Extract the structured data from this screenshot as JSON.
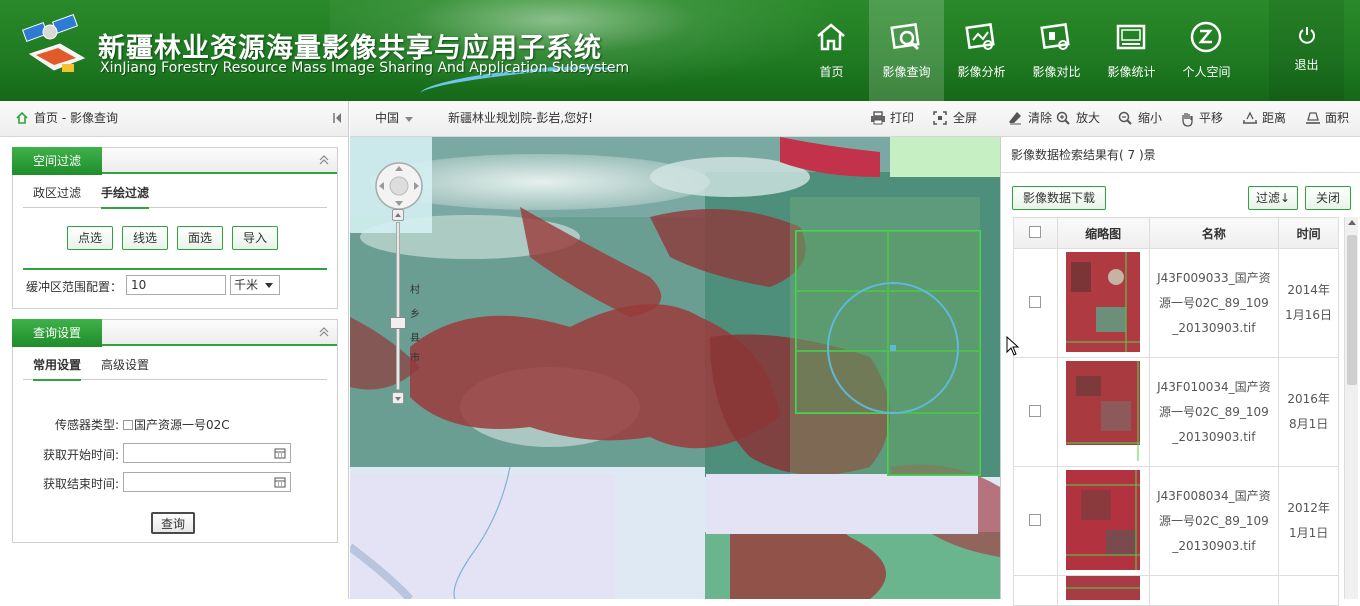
{
  "header": {
    "title_cn": "新疆林业资源海量影像共享与应用子系统",
    "title_en": "XinJiang Forestry Resource Mass Image Sharing And Application Subsystem",
    "nav": [
      {
        "label": "首页",
        "icon": "home-icon"
      },
      {
        "label": "影像查询",
        "icon": "image-search-icon",
        "active": true
      },
      {
        "label": "影像分析",
        "icon": "image-analysis-icon"
      },
      {
        "label": "影像对比",
        "icon": "image-compare-icon"
      },
      {
        "label": "影像统计",
        "icon": "image-stats-icon"
      },
      {
        "label": "个人空间",
        "icon": "personal-space-icon"
      },
      {
        "label": "退出",
        "icon": "power-icon"
      }
    ]
  },
  "breadcrumb": "首页 - 影像查询",
  "spatial_filter": {
    "title": "空间过滤",
    "tabs": [
      "政区过滤",
      "手绘过滤"
    ],
    "active_tab": "手绘过滤",
    "buttons": [
      "点选",
      "线选",
      "面选",
      "导入"
    ],
    "buffer_label": "缓冲区范围配置：",
    "buffer_value": "10",
    "buffer_unit": "千米"
  },
  "query_settings": {
    "title": "查询设置",
    "tabs": [
      "常用设置",
      "高级设置"
    ],
    "active_tab": "常用设置",
    "sensor_label": "传感器类型:",
    "sensor_value": "国产资源一号02C",
    "start_label": "获取开始时间:",
    "start_value": "",
    "end_label": "获取结束时间:",
    "end_value": "",
    "query_button": "查询"
  },
  "toolbar": {
    "region": "中国",
    "greeting": "新疆林业规划院-彭岩,您好!",
    "tools": [
      {
        "label": "打印",
        "icon": "print-icon"
      },
      {
        "label": "全屏",
        "icon": "fullscreen-icon"
      },
      {
        "label": "清除",
        "icon": "clear-icon"
      },
      {
        "label": "放大",
        "icon": "zoom-in-icon"
      },
      {
        "label": "缩小",
        "icon": "zoom-out-icon"
      },
      {
        "label": "平移",
        "icon": "pan-icon"
      },
      {
        "label": "距离",
        "icon": "distance-icon"
      },
      {
        "label": "面积",
        "icon": "area-icon"
      }
    ]
  },
  "map": {
    "zoom_labels": [
      "村",
      "乡",
      "县",
      "市"
    ]
  },
  "results": {
    "summary": "影像数据检索结果有( 7 )景",
    "download_button": "影像数据下载",
    "filter_button": "过滤↓",
    "close_button": "关闭",
    "columns": [
      "缩略图",
      "名称",
      "时间"
    ],
    "rows": [
      {
        "name": "J43F009033_国产资源一号02C_89_109_20130903.tif",
        "name_lines": [
          "J43F009033_国产资",
          "源一号02C_89_109",
          "_20130903.tif"
        ],
        "time_lines": [
          "2014年",
          "1月16日"
        ]
      },
      {
        "name": "J43F010034_国产资源一号02C_89_109_20130903.tif",
        "name_lines": [
          "J43F010034_国产资",
          "源一号02C_89_109",
          "_20130903.tif"
        ],
        "time_lines": [
          "2016年",
          "8月1日"
        ]
      },
      {
        "name": "J43F008034_国产资源一号02C_89_109_20130903.tif",
        "name_lines": [
          "J43F008034_国产资",
          "源一号02C_89_109",
          "_20130903.tif"
        ],
        "time_lines": [
          "2012年",
          "1月1日"
        ]
      }
    ]
  }
}
